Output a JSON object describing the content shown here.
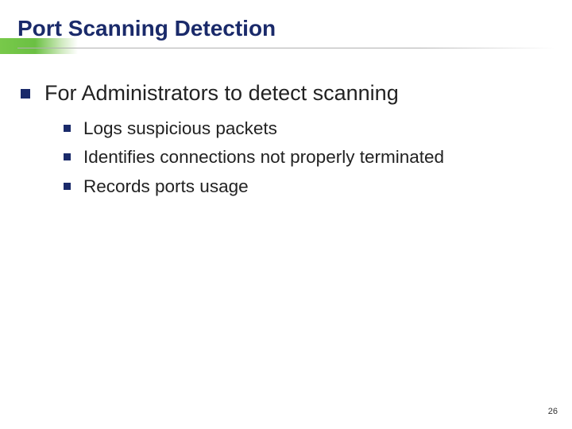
{
  "slide": {
    "title": "Port Scanning Detection",
    "main_point": "For Administrators to detect scanning",
    "sub_points": [
      "Logs suspicious packets",
      "Identifies connections not properly terminated",
      "Records ports usage"
    ],
    "page_number": "26"
  }
}
